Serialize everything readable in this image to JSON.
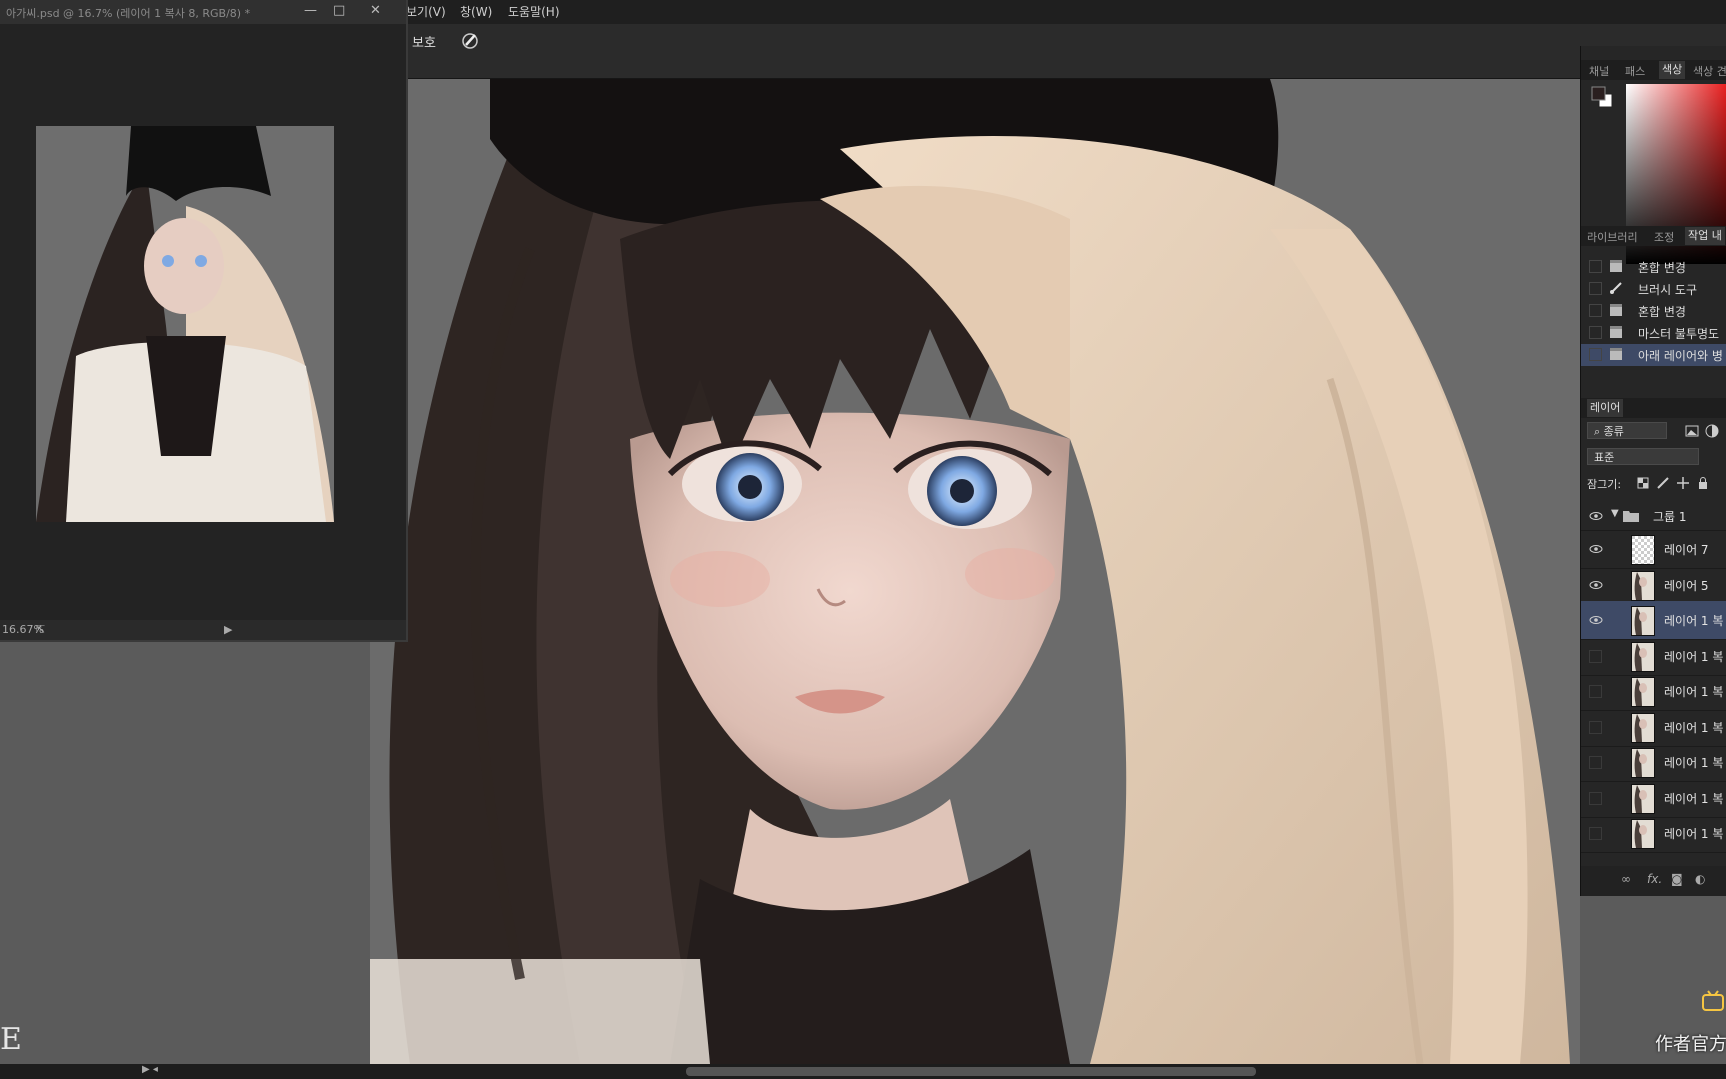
{
  "document": {
    "title": "아가씨.psd @ 16.7% (레이어 1 복사 8, RGB/8) *",
    "zoom": "16.67%"
  },
  "menubar": {
    "items": [
      "보기(V)",
      "창(W)",
      "도움말(H)"
    ]
  },
  "options": {
    "label": "보호"
  },
  "right_panel": {
    "top_tabs": [
      "채널",
      "패스",
      "색상",
      "색상 견"
    ],
    "active_top_tab": "색상",
    "history_tabs": [
      "라이브러리",
      "조정",
      "작업 내"
    ],
    "history": [
      {
        "label": "혼합 변경",
        "icon": "document-icon",
        "selected": false
      },
      {
        "label": "브러시 도구",
        "icon": "brush-icon",
        "selected": false
      },
      {
        "label": "혼합 변경",
        "icon": "document-icon",
        "selected": false
      },
      {
        "label": "마스터 불투명도",
        "icon": "document-icon",
        "selected": false
      },
      {
        "label": "아래 레이어와 병",
        "icon": "document-icon",
        "selected": true
      }
    ],
    "layers_tab": "레이어",
    "filter_label": "종류",
    "blend_mode": "표준",
    "lock_label": "잠그기:",
    "group_name": "그룹 1",
    "layers": [
      {
        "name": "레이어 7",
        "visible": true,
        "selected": false,
        "thumb": "transparent"
      },
      {
        "name": "레이어 5",
        "visible": true,
        "selected": false,
        "thumb": "sketch"
      },
      {
        "name": "레이어 1 복",
        "visible": true,
        "selected": true,
        "thumb": "portrait"
      },
      {
        "name": "레이어 1 복",
        "visible": false,
        "selected": false,
        "thumb": "portrait"
      },
      {
        "name": "레이어 1 복",
        "visible": false,
        "selected": false,
        "thumb": "portrait"
      },
      {
        "name": "레이어 1 복",
        "visible": false,
        "selected": false,
        "thumb": "portrait"
      },
      {
        "name": "레이어 1 복",
        "visible": false,
        "selected": false,
        "thumb": "portrait"
      },
      {
        "name": "레이어 1 복",
        "visible": false,
        "selected": false,
        "thumb": "portrait"
      },
      {
        "name": "레이어 1 복",
        "visible": false,
        "selected": false,
        "thumb": "portrait"
      }
    ],
    "footer_icons": [
      "link-icon",
      "fx-icon",
      "mask-icon",
      "adjustment-icon"
    ],
    "footer_fx": "fx."
  },
  "watermark": {
    "text": "作者官方",
    "logo": "bilibili-logo"
  },
  "corner_mark": "E",
  "colors": {
    "accent_selected": "#3e4a66",
    "foreground": "#2a1f1f",
    "background": "#ffffff"
  }
}
